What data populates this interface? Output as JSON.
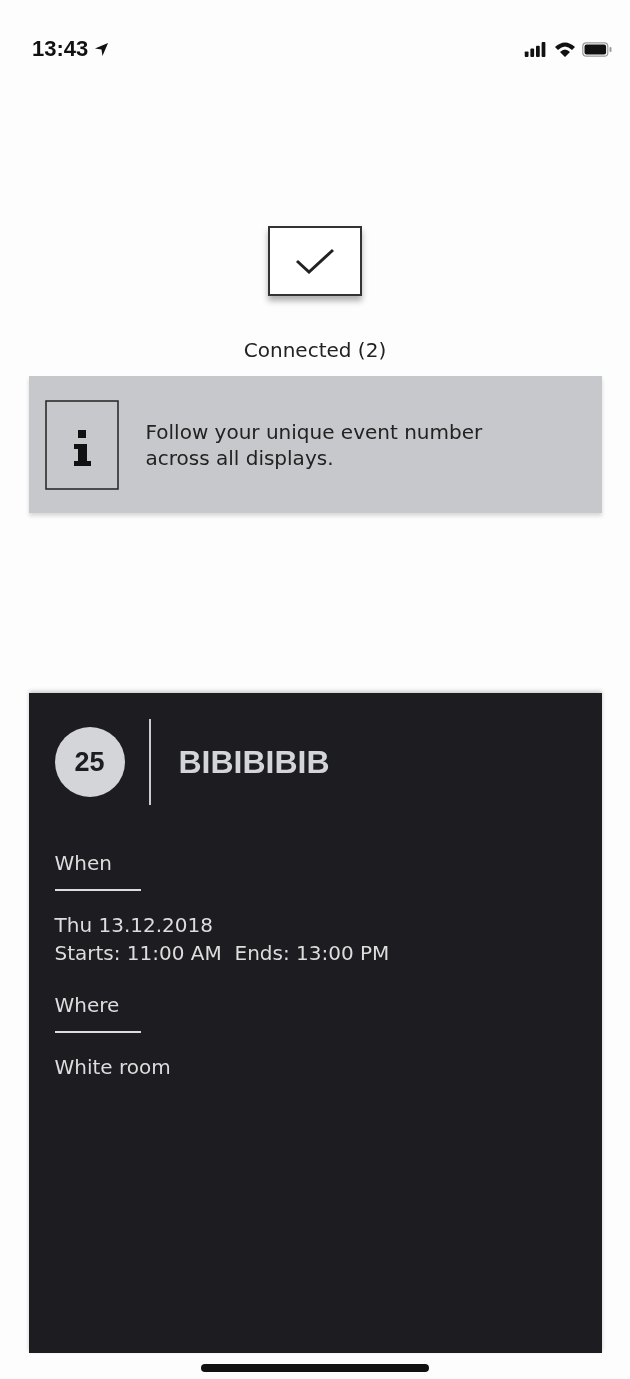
{
  "status_bar": {
    "time": "13:43"
  },
  "connection": {
    "label": "Connected (2)"
  },
  "info": {
    "text": "Follow your unique event number across all displays."
  },
  "event": {
    "number": "25",
    "title": "BIBIBIBIB",
    "sections": [
      {
        "heading": "When",
        "lines": [
          "Thu 13.12.2018",
          "Starts: 11:00 AM  Ends: 13:00 PM"
        ]
      },
      {
        "heading": "Where",
        "lines": [
          "White room"
        ]
      }
    ]
  }
}
